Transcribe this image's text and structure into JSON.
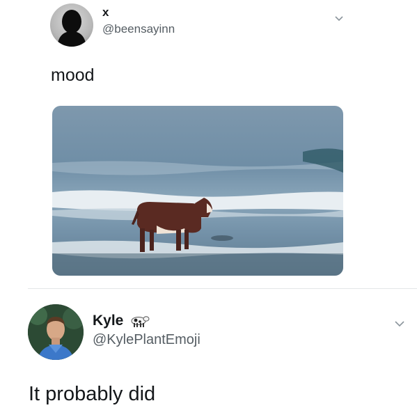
{
  "tweet1": {
    "name": "x",
    "handle": "@beensayinn",
    "text": "mood",
    "menu_icon": "chevron-down-icon",
    "photo_alt": "cow standing in the ocean surf"
  },
  "tweet2": {
    "name": "Kyle",
    "name_badge_icon": "cow-emoji-icon",
    "handle": "@KylePlantEmoji",
    "text": "It probably did",
    "menu_icon": "chevron-down-icon"
  },
  "colors": {
    "text": "#14171a",
    "handle": "#555d63",
    "divider": "#e3e6e8",
    "sea": "#6f8fa6",
    "cow": "#5a2a22"
  }
}
